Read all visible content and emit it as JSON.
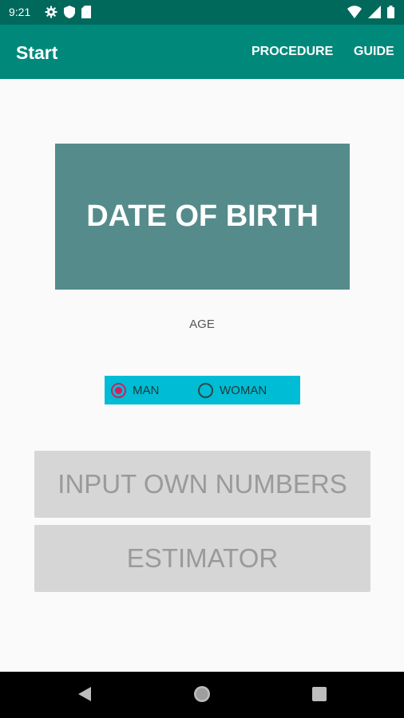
{
  "status_bar": {
    "time": "9:21",
    "left_icons": [
      "settings-icon",
      "shield-icon",
      "sd-card-icon"
    ],
    "right_icons": [
      "wifi-icon",
      "signal-icon",
      "battery-icon"
    ]
  },
  "app_bar": {
    "title": "Start",
    "actions": [
      "PROCEDURE",
      "GUIDE"
    ],
    "color": "#00897b"
  },
  "date_of_birth_button": {
    "label": "DATE OF BIRTH",
    "color": "#558b8b"
  },
  "age_label": "AGE",
  "gender": {
    "options": [
      {
        "label": "MAN",
        "checked": true
      },
      {
        "label": "WOMAN",
        "checked": false
      }
    ],
    "background": "#00bcd4",
    "accent": "#d81b60"
  },
  "buttons": {
    "input_own_numbers": "INPUT OWN NUMBERS",
    "estimator": "ESTIMATOR"
  },
  "nav_bar": [
    "back-icon",
    "home-icon",
    "recents-icon"
  ]
}
